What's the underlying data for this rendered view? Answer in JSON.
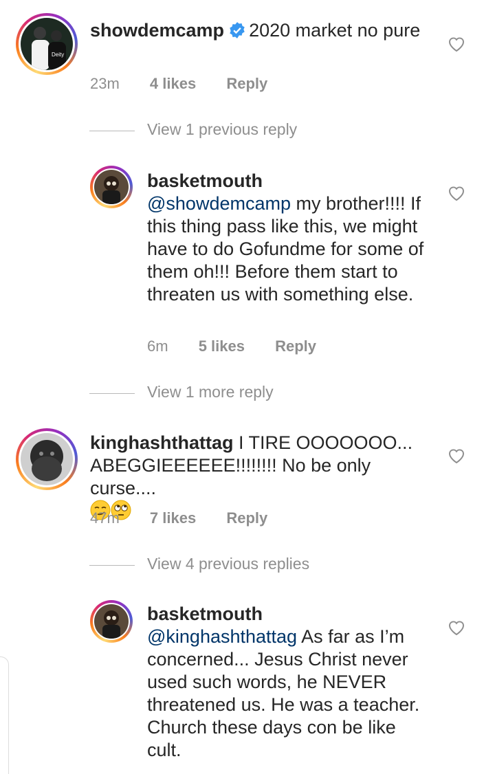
{
  "comments": [
    {
      "username": "showdemcamp",
      "verified": true,
      "text": "2020 market no pure",
      "time": "23m",
      "likes": "4 likes",
      "reply": "Reply",
      "view_replies": "View 1 previous reply"
    },
    {
      "username": "basketmouth",
      "mention": "@showdemcamp",
      "text": " my brother!!!! If this thing pass like this, we might have to do Gofundme for some of them oh!!! Before them start to threaten us with something else.",
      "time": "6m",
      "likes": "5 likes",
      "reply": "Reply",
      "view_replies": "View 1 more reply"
    },
    {
      "username": "kinghashthattag",
      "text": "I TIRE OOOOOOO... ABEGGIEEEEEE!!!!!!!! No be only curse....",
      "emojis": [
        "smirking-face",
        "face-with-rolling-eyes"
      ],
      "time": "47m",
      "likes": "7 likes",
      "reply": "Reply",
      "view_replies": "View 4 previous replies"
    },
    {
      "username": "basketmouth",
      "mention": "@kinghashthattag",
      "text": " As far as I’m concerned... Jesus Christ never used such words, he NEVER threatened us. He was a teacher. Church these days con be like cult."
    }
  ],
  "colors": {
    "text": "#262626",
    "meta": "#8e8e8e",
    "mention": "#003569",
    "verified": "#3897f0"
  }
}
